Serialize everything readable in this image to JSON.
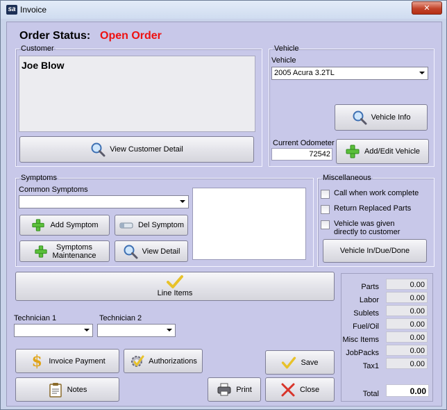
{
  "window": {
    "title": "Invoice",
    "app_icon_text": "sa"
  },
  "order_status": {
    "label": "Order Status:",
    "value": "Open Order",
    "value_color": "#ee1111"
  },
  "customer": {
    "legend": "Customer",
    "name": "Joe Blow",
    "view_detail_label": "View Customer Detail"
  },
  "vehicle": {
    "legend": "Vehicle",
    "field_label": "Vehicle",
    "selected": "2005 Acura 3.2TL",
    "info_label": "Vehicle Info",
    "odometer_label": "Current Odometer",
    "odometer_value": "72542",
    "add_edit_label": "Add/Edit Vehicle"
  },
  "symptoms": {
    "legend": "Symptoms",
    "common_label": "Common Symptoms",
    "selected": "",
    "add_label": "Add Symptom",
    "del_label": "Del Symptom",
    "maintenance_label_1": "Symptoms",
    "maintenance_label_2": "Maintenance",
    "view_detail_label": "View Detail"
  },
  "misc": {
    "legend": "Miscellaneous",
    "call_when_complete": "Call when work complete",
    "return_parts": "Return Replaced Parts",
    "given_line_1": "Vehicle was given",
    "given_line_2": "directly to customer",
    "in_due_done_label": "Vehicle In/Due/Done"
  },
  "line_items_label": "Line Items",
  "technicians": {
    "tech1_label": "Technician 1",
    "tech2_label": "Technician 2",
    "tech1_value": "",
    "tech2_value": ""
  },
  "buttons": {
    "invoice_payment": "Invoice Payment",
    "authorizations": "Authorizations",
    "save": "Save",
    "notes": "Notes",
    "print": "Print",
    "close": "Close"
  },
  "totals": {
    "rows": [
      {
        "label": "Parts",
        "value": "0.00"
      },
      {
        "label": "Labor",
        "value": "0.00"
      },
      {
        "label": "Sublets",
        "value": "0.00"
      },
      {
        "label": "Fuel/Oil",
        "value": "0.00"
      },
      {
        "label": "Misc Items",
        "value": "0.00"
      },
      {
        "label": "JobPacks",
        "value": "0.00"
      },
      {
        "label": "Tax1",
        "value": "0.00"
      }
    ],
    "total_label": "Total",
    "total_value": "0.00"
  }
}
